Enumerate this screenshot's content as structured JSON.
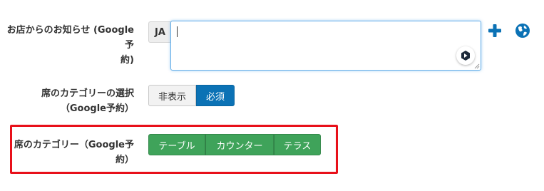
{
  "rows": {
    "notice": {
      "label_line1": "お店からのお知らせ (Google予",
      "label_line2": "約)"
    },
    "category_select": {
      "label_line1": "席のカテゴリーの選択",
      "label_line2": "（Google予約）"
    },
    "category": {
      "label_line1": "席のカテゴリー（Google予",
      "label_line2": "約）"
    }
  },
  "language_badge": "JA",
  "textarea_value": "",
  "toggle": {
    "options": [
      "非表示",
      "必須"
    ],
    "selected": "必須"
  },
  "categories": [
    "テーブル",
    "カウンター",
    "テラス"
  ],
  "icons": [
    "plus-icon",
    "globe-icon",
    "assistant-icon"
  ],
  "colors": {
    "accent": "#0b72b5",
    "green": "#3fa35a",
    "highlight": "#e8101a"
  }
}
